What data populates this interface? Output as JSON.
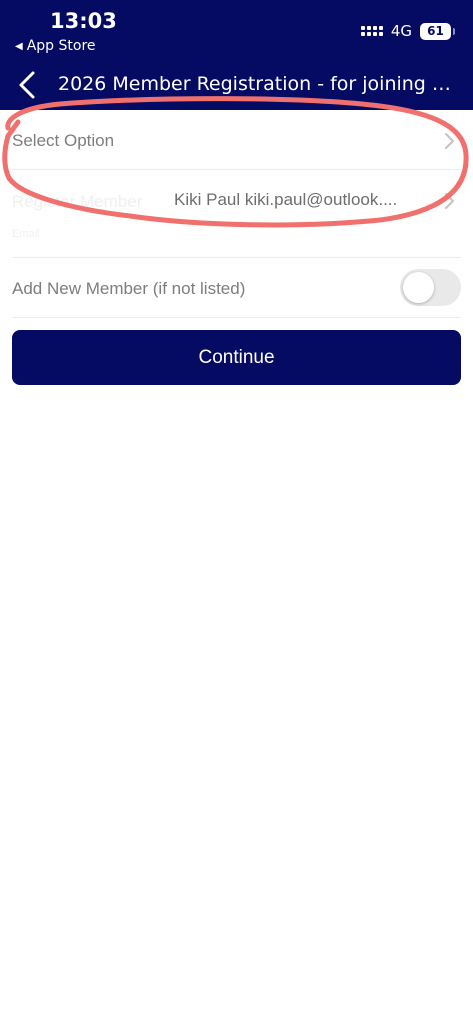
{
  "status_bar": {
    "time": "13:03",
    "back_app": "App Store",
    "network": "4G",
    "battery": "61"
  },
  "nav": {
    "title": "2026 Member Registration - for joining pa...",
    "back_icon": "chevron-left-icon"
  },
  "form": {
    "select_option": "Select Option",
    "register_member_label": "Register Member",
    "register_member_sub": "Email",
    "register_member_value": "Kiki Paul kiki.paul@outlook....",
    "add_new_member_label": "Add New Member (if not listed)",
    "add_new_member_on": false,
    "continue_label": "Continue"
  },
  "colors": {
    "header_bg": "#050b63",
    "button_bg": "#050b63",
    "annotation": "#f0706e"
  }
}
